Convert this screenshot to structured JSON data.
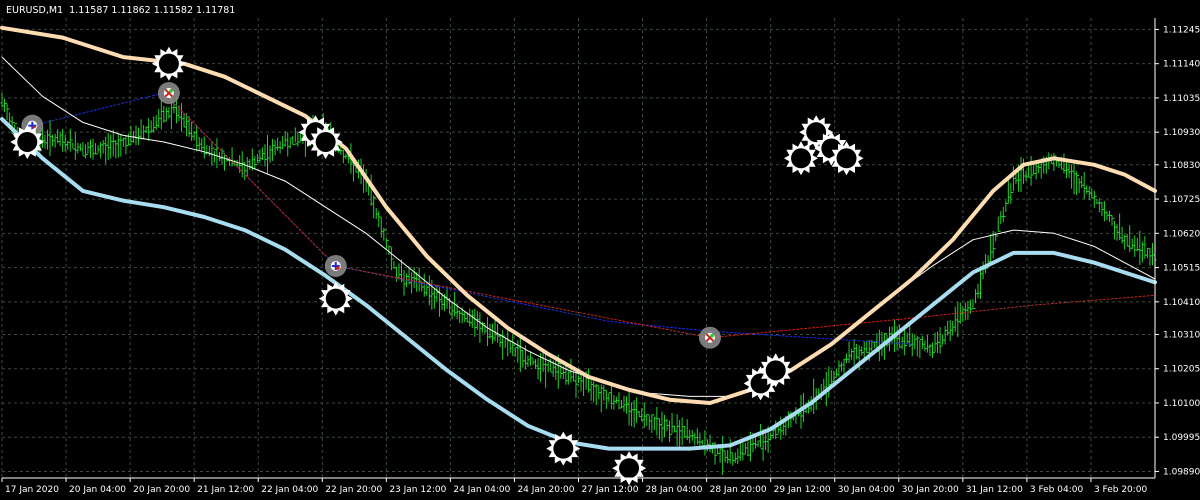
{
  "header": {
    "symbol": "EURUSD,M1",
    "quote": "1.11587 1.11862 1.11582 1.11781"
  },
  "colors": {
    "background": "#000000",
    "grid": "#3a4a3a",
    "bars": "#23d12c",
    "upper_band": "#ffdcb1",
    "lower_band": "#a8dcf0",
    "mid_line": "#ffffff",
    "dotted_blue": "#1a2ed8",
    "dotted_red": "#c8221b",
    "marker": "#ffffff"
  },
  "chart_data": {
    "type": "line",
    "y_ticks": [
      "1.11245",
      "1.11140",
      "1.11035",
      "1.10930",
      "1.10830",
      "1.10725",
      "1.10620",
      "1.10515",
      "1.10410",
      "1.10310",
      "1.10205",
      "1.10100",
      "1.09995",
      "1.09890"
    ],
    "x_labels": [
      "17 Jan 2020",
      "20 Jan 04:00",
      "20 Jan 20:00",
      "21 Jan 12:00",
      "22 Jan 04:00",
      "22 Jan 20:00",
      "23 Jan 12:00",
      "24 Jan 04:00",
      "24 Jan 20:00",
      "27 Jan 12:00",
      "28 Jan 04:00",
      "28 Jan 20:00",
      "29 Jan 12:00",
      "30 Jan 04:00",
      "30 Jan 20:00",
      "31 Jan 12:00",
      "3 Feb 04:00",
      "3 Feb 20:00"
    ],
    "ylim": [
      1.0987,
      1.1128
    ],
    "x_index_range": [
      0,
      114
    ],
    "series": [
      {
        "key": "price",
        "x": [
          0,
          2,
          5,
          9,
          13,
          17,
          20,
          24,
          28,
          32,
          36,
          39,
          42,
          45,
          49,
          52,
          55,
          57,
          60,
          64,
          68,
          72,
          76,
          80,
          84,
          88,
          92,
          96,
          100,
          104,
          108,
          111,
          114
        ],
        "y": [
          1.1102,
          1.109,
          1.1091,
          1.1087,
          1.1091,
          1.11,
          1.1088,
          1.1082,
          1.109,
          1.1093,
          1.1078,
          1.105,
          1.1045,
          1.1038,
          1.103,
          1.1023,
          1.102,
          1.1017,
          1.1012,
          1.1005,
          1.1,
          1.0993,
          1.1,
          1.101,
          1.1025,
          1.103,
          1.1027,
          1.104,
          1.1078,
          1.1085,
          1.1073,
          1.106,
          1.1055
        ]
      },
      {
        "key": "upper",
        "x": [
          0,
          6,
          12,
          18,
          22,
          26,
          30,
          34,
          38,
          42,
          46,
          50,
          54,
          58,
          62,
          66,
          70,
          74,
          78,
          82,
          86,
          90,
          94,
          98,
          101,
          104,
          108,
          111,
          114
        ],
        "y": [
          1.1125,
          1.1122,
          1.1116,
          1.1114,
          1.111,
          1.1104,
          1.1098,
          1.1088,
          1.107,
          1.1055,
          1.1043,
          1.1033,
          1.1025,
          1.1018,
          1.1014,
          1.1011,
          1.101,
          1.1014,
          1.102,
          1.1028,
          1.1038,
          1.1048,
          1.106,
          1.1075,
          1.1083,
          1.1085,
          1.1083,
          1.108,
          1.1075
        ]
      },
      {
        "key": "lower",
        "x": [
          0,
          4,
          8,
          12,
          16,
          20,
          24,
          28,
          32,
          36,
          40,
          44,
          48,
          52,
          56,
          60,
          64,
          68,
          72,
          76,
          80,
          84,
          88,
          92,
          96,
          100,
          104,
          108,
          111,
          114
        ],
        "y": [
          1.1097,
          1.1085,
          1.1075,
          1.1072,
          1.107,
          1.1067,
          1.1063,
          1.1057,
          1.1049,
          1.104,
          1.103,
          1.102,
          1.1011,
          1.1003,
          1.0998,
          1.0996,
          1.0996,
          1.0996,
          1.0997,
          1.1002,
          1.101,
          1.102,
          1.103,
          1.104,
          1.105,
          1.1056,
          1.1056,
          1.1053,
          1.105,
          1.1047
        ]
      },
      {
        "key": "mid",
        "x": [
          0,
          4,
          8,
          12,
          16,
          20,
          24,
          28,
          32,
          36,
          40,
          44,
          48,
          52,
          56,
          60,
          64,
          68,
          72,
          76,
          80,
          84,
          88,
          92,
          96,
          100,
          104,
          108,
          111,
          114
        ],
        "y": [
          1.1116,
          1.1104,
          1.1096,
          1.1092,
          1.109,
          1.1087,
          1.1083,
          1.1078,
          1.107,
          1.1062,
          1.1052,
          1.1042,
          1.1033,
          1.1026,
          1.102,
          1.1016,
          1.1013,
          1.1012,
          1.1012,
          1.1016,
          1.1024,
          1.1033,
          1.1043,
          1.1052,
          1.106,
          1.1063,
          1.1062,
          1.1058,
          1.1053,
          1.1048
        ]
      },
      {
        "key": "dotted_blue",
        "x": [
          3,
          16,
          33,
          60,
          70,
          90
        ],
        "y": [
          1.1095,
          1.1105,
          1.1052,
          1.1035,
          1.1032,
          1.1028
        ]
      },
      {
        "key": "dotted_red",
        "x": [
          16,
          33,
          70,
          90,
          102,
          114
        ],
        "y": [
          1.1105,
          1.1052,
          1.103,
          1.1036,
          1.104,
          1.1043
        ]
      }
    ],
    "signals": [
      {
        "x": 3,
        "y": 1.1095,
        "kind": "buy"
      },
      {
        "x": 16.5,
        "y": 1.1105,
        "kind": "sell"
      },
      {
        "x": 33,
        "y": 1.1052,
        "kind": "buy"
      },
      {
        "x": 70,
        "y": 1.103,
        "kind": "sell"
      }
    ],
    "markers": [
      {
        "x": 2.5,
        "y": 1.109
      },
      {
        "x": 16.5,
        "y": 1.1114
      },
      {
        "x": 31,
        "y": 1.1093
      },
      {
        "x": 32,
        "y": 1.109
      },
      {
        "x": 33,
        "y": 1.1042
      },
      {
        "x": 55.5,
        "y": 1.0996
      },
      {
        "x": 62,
        "y": 1.099
      },
      {
        "x": 75,
        "y": 1.1016
      },
      {
        "x": 76.5,
        "y": 1.102
      },
      {
        "x": 79,
        "y": 1.1085
      },
      {
        "x": 80.5,
        "y": 1.1093
      },
      {
        "x": 82,
        "y": 1.1088
      },
      {
        "x": 83.5,
        "y": 1.1085
      }
    ]
  }
}
